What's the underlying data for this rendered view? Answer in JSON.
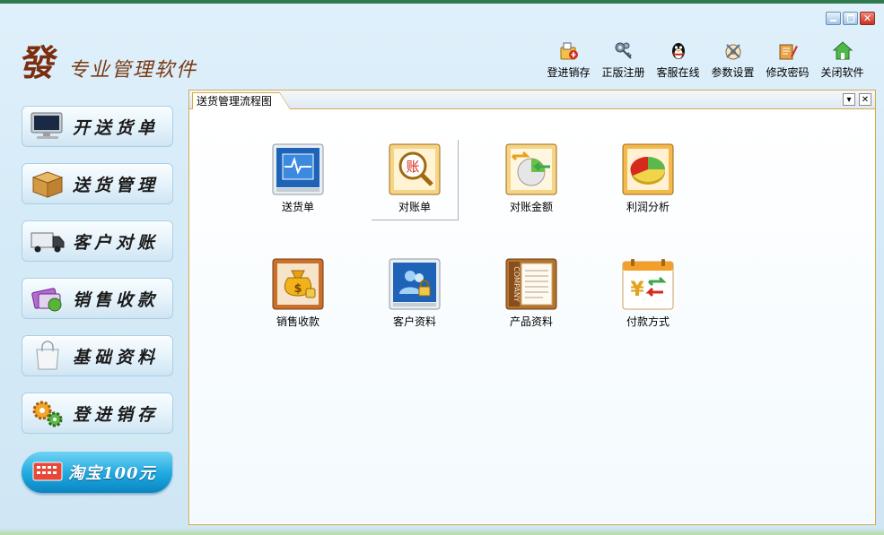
{
  "app": {
    "logo_mark": "發",
    "logo_text": "专业管理软件"
  },
  "toolbar": [
    {
      "label": "登进销存",
      "icon": "upload-box-icon"
    },
    {
      "label": "正版注册",
      "icon": "keys-icon"
    },
    {
      "label": "客服在线",
      "icon": "qq-penguin-icon"
    },
    {
      "label": "参数设置",
      "icon": "settings-tools-icon"
    },
    {
      "label": "修改密码",
      "icon": "edit-password-icon"
    },
    {
      "label": "关闭软件",
      "icon": "exit-house-icon"
    }
  ],
  "sidebar": {
    "items": [
      {
        "label": "开送货单",
        "icon": "monitor-icon"
      },
      {
        "label": "送货管理",
        "icon": "package-box-icon"
      },
      {
        "label": "客户对账",
        "icon": "truck-icon"
      },
      {
        "label": "销售收款",
        "icon": "card-payment-icon"
      },
      {
        "label": "基础资料",
        "icon": "shopping-bag-icon"
      },
      {
        "label": "登进销存",
        "icon": "gears-icon"
      }
    ],
    "taobao_label": "淘宝100元"
  },
  "panel": {
    "tab_title": "送货管理流程图",
    "items": [
      {
        "label": "送货单",
        "icon": "delivery-note-icon"
      },
      {
        "label": "对账单",
        "icon": "statement-magnifier-icon"
      },
      {
        "label": "对账金额",
        "icon": "reconcile-amount-icon"
      },
      {
        "label": "利润分析",
        "icon": "pie-chart-icon"
      },
      {
        "label": "销售收款",
        "icon": "money-bag-icon"
      },
      {
        "label": "客户资料",
        "icon": "customer-lock-icon"
      },
      {
        "label": "产品资料",
        "icon": "company-document-icon"
      },
      {
        "label": "付款方式",
        "icon": "payment-calendar-icon"
      }
    ]
  },
  "colors": {
    "accent_border": "#d8a94a",
    "background": "#d6ebf8",
    "taobao_blue": "#1ea8de"
  }
}
